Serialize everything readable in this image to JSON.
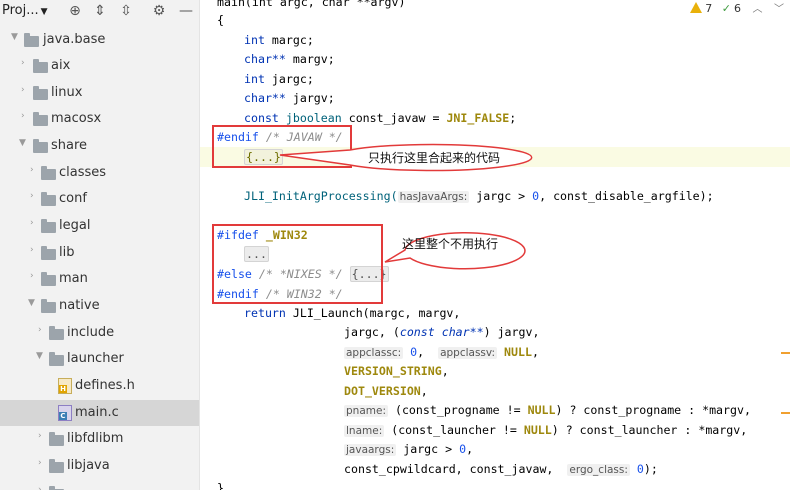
{
  "sidebar": {
    "title": "Proj...",
    "tree": [
      {
        "label": "java.base",
        "kind": "folder",
        "expanded": true
      },
      {
        "label": "aix",
        "kind": "folder",
        "expanded": false
      },
      {
        "label": "linux",
        "kind": "folder",
        "expanded": false
      },
      {
        "label": "macosx",
        "kind": "folder",
        "expanded": false
      },
      {
        "label": "share",
        "kind": "folder",
        "expanded": true
      },
      {
        "label": "classes",
        "kind": "folder",
        "expanded": false
      },
      {
        "label": "conf",
        "kind": "folder",
        "expanded": false
      },
      {
        "label": "legal",
        "kind": "folder",
        "expanded": false
      },
      {
        "label": "lib",
        "kind": "folder",
        "expanded": false
      },
      {
        "label": "man",
        "kind": "folder",
        "expanded": false
      },
      {
        "label": "native",
        "kind": "folder",
        "expanded": true
      },
      {
        "label": "include",
        "kind": "folder",
        "expanded": false
      },
      {
        "label": "launcher",
        "kind": "folder",
        "expanded": true
      },
      {
        "label": "defines.h",
        "kind": "header-file"
      },
      {
        "label": "main.c",
        "kind": "c-file",
        "selected": true
      },
      {
        "label": "libfdlibm",
        "kind": "folder",
        "expanded": false
      },
      {
        "label": "libjava",
        "kind": "folder",
        "expanded": false
      }
    ]
  },
  "inspections": {
    "warnings": "7",
    "weak_warnings": "6"
  },
  "code": {
    "l0": "main(int argc, char **argv)",
    "l1": "{",
    "l2_type": "int",
    "l2_name": " margc;",
    "l3_type": "char**",
    "l3_name": " margv;",
    "l4_type": "int",
    "l4_name": " jargc;",
    "l5_type": "char**",
    "l5_name": " jargv;",
    "l6_kw": "const",
    "l6_type": " jboolean",
    "l6_rest": " const_javaw = ",
    "l6_macro": "JNI_FALSE",
    "l6_end": ";",
    "l7_pp": "#endif",
    "l7_cm": " /* JAVAW */",
    "l8_fold": "{...}",
    "l9_fn": "JLI_InitArgProcessing(",
    "l9_hint": "hasJavaArgs:",
    "l9_a": " jargc > ",
    "l9_zero": "0",
    "l9_b": ", const_disable_argfile);",
    "l10_pp": "#ifdef",
    "l10_macro": " _WIN32",
    "l11_dots": "...",
    "l12_pp": "#else",
    "l12_cm": " /* *NIXES */ ",
    "l12_fold": "{...}",
    "l13_pp": "#endif",
    "l13_cm": " /* WIN32 */",
    "l14_kw": "return",
    "l14_rest": " JLI_Launch(margc, margv,",
    "l15_a": "jargc, (",
    "l15_kw": "const char**",
    "l15_b": ") jargv,",
    "l16_h1": "appclassc:",
    "l16_v1": " 0",
    "l16_sep": ",  ",
    "l16_h2": "appclassv:",
    "l16_v2": " NULL",
    "l16_end": ",",
    "l17_macro": "VERSION_STRING",
    "l17_end": ",",
    "l18_macro": "DOT_VERSION",
    "l18_end": ",",
    "l19_hint": "pname:",
    "l19_a": " (const_progname != ",
    "l19_null": "NULL",
    "l19_b": ") ? const_progname : *margv,",
    "l20_hint": "lname:",
    "l20_a": " (const_launcher != ",
    "l20_null": "NULL",
    "l20_b": ") ? const_launcher : *margv,",
    "l21_hint": "javaargs:",
    "l21_a": " jargc > ",
    "l21_zero": "0",
    "l21_end": ",",
    "l22_a": "const_cpwildcard, const_javaw,  ",
    "l22_hint": "ergo_class:",
    "l22_zero": " 0",
    "l22_end": ");",
    "l23": "}"
  },
  "annotations": {
    "callout_1": "只执行这里合起来的代码",
    "callout_2": "这里整个不用执行",
    "color": "#e23a3a"
  }
}
